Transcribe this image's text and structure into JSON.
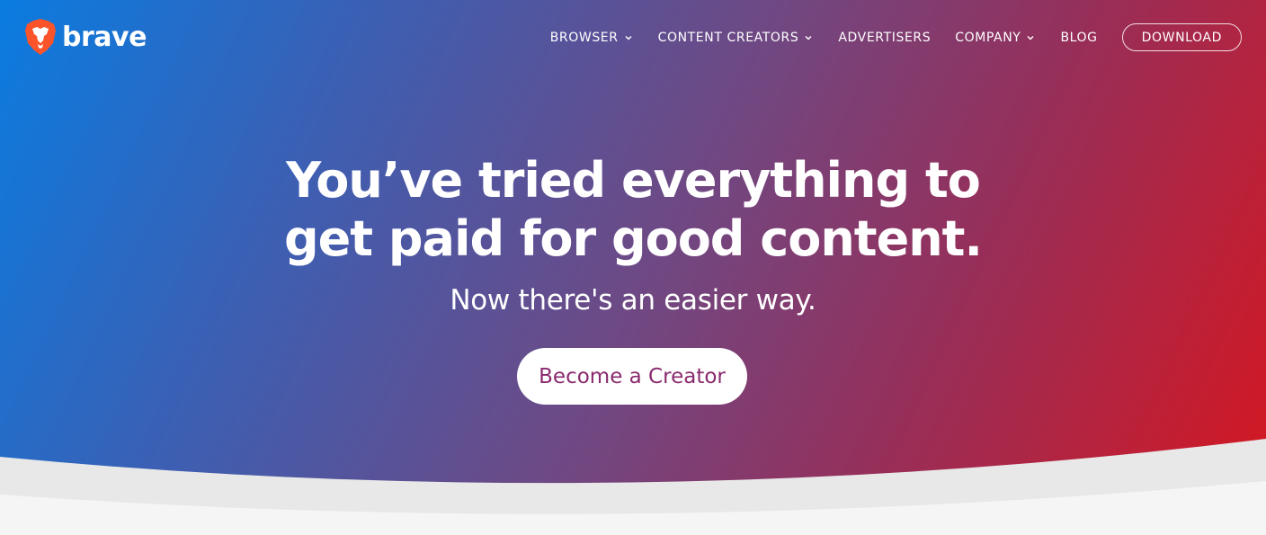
{
  "brand": {
    "name": "brave",
    "logo_icon": "brave-lion-icon",
    "logo_color": "#fb542b"
  },
  "nav": {
    "items": [
      {
        "label": "BROWSER",
        "has_dropdown": true
      },
      {
        "label": "CONTENT CREATORS",
        "has_dropdown": true
      },
      {
        "label": "ADVERTISERS",
        "has_dropdown": false
      },
      {
        "label": "COMPANY",
        "has_dropdown": true
      },
      {
        "label": "BLOG",
        "has_dropdown": false
      }
    ],
    "download_label": "DOWNLOAD"
  },
  "hero": {
    "headline_line1": "You’ve tried everything to",
    "headline_line2": "get paid for good content.",
    "subhead": "Now there's an easier way.",
    "cta_label": "Become a Creator",
    "gradient_start": "#0a7ce0",
    "gradient_end": "#d7161f",
    "cta_text_color": "#8a2a6e"
  }
}
